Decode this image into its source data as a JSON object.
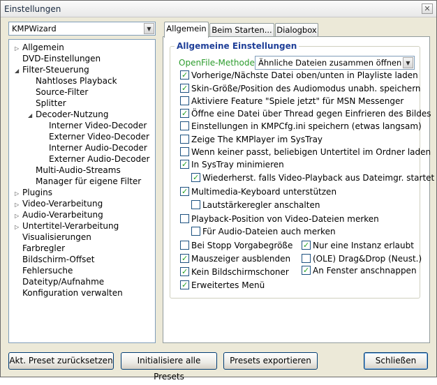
{
  "window": {
    "title": "Einstellungen",
    "close_glyph": "✕"
  },
  "preset": {
    "value": "KMPWizard"
  },
  "tree": {
    "items": [
      {
        "label": "Allgemein",
        "level": 0,
        "exp": "▷"
      },
      {
        "label": "DVD-Einstellungen",
        "level": 0,
        "exp": ""
      },
      {
        "label": "Filter-Steuerung",
        "level": 0,
        "exp": "◢"
      },
      {
        "label": "Nahtloses Playback",
        "level": 1,
        "exp": ""
      },
      {
        "label": "Source-Filter",
        "level": 1,
        "exp": ""
      },
      {
        "label": "Splitter",
        "level": 1,
        "exp": ""
      },
      {
        "label": "Decoder-Nutzung",
        "level": 1,
        "exp": "◢"
      },
      {
        "label": "Interner Video-Decoder",
        "level": 2,
        "exp": ""
      },
      {
        "label": "Externer Video-Decoder",
        "level": 2,
        "exp": ""
      },
      {
        "label": "Interner Audio-Decoder",
        "level": 2,
        "exp": ""
      },
      {
        "label": "Externer Audio-Decoder",
        "level": 2,
        "exp": ""
      },
      {
        "label": "Multi-Audio-Streams",
        "level": 1,
        "exp": ""
      },
      {
        "label": "Manager für eigene Filter",
        "level": 1,
        "exp": ""
      },
      {
        "label": "Plugins",
        "level": 0,
        "exp": "▷"
      },
      {
        "label": "Video-Verarbeitung",
        "level": 0,
        "exp": "▷"
      },
      {
        "label": "Audio-Verarbeitung",
        "level": 0,
        "exp": "▷"
      },
      {
        "label": "Untertitel-Verarbeitung",
        "level": 0,
        "exp": "▷"
      },
      {
        "label": "Visualisierungen",
        "level": 0,
        "exp": ""
      },
      {
        "label": "Farbregler",
        "level": 0,
        "exp": ""
      },
      {
        "label": "Bildschirm-Offset",
        "level": 0,
        "exp": ""
      },
      {
        "label": "Fehlersuche",
        "level": 0,
        "exp": ""
      },
      {
        "label": "Dateityp/Aufnahme",
        "level": 0,
        "exp": ""
      },
      {
        "label": "Konfiguration verwalten",
        "level": 0,
        "exp": ""
      }
    ]
  },
  "tabs": [
    {
      "label": "Allgemein",
      "active": true
    },
    {
      "label": "Beim Starten...",
      "active": false
    },
    {
      "label": "Dialogbox",
      "active": false
    }
  ],
  "group": {
    "title": "Allgemeine Einstellungen",
    "openfile_label": "OpenFile-Methode:",
    "openfile_value": "Ähnliche Dateien zusammen öffnen (V",
    "options": [
      {
        "label": "Vorherige/Nächste Datei oben/unten in Playliste laden",
        "checked": true,
        "indent": 0
      },
      {
        "label": "Skin-Größe/Position des Audiomodus unabh. speichern",
        "checked": true,
        "indent": 0
      },
      {
        "label": "Aktiviere Feature \"Spiele jetzt\" für MSN Messenger",
        "checked": false,
        "indent": 0
      },
      {
        "label": "Öffne eine Datei über Thread gegen Einfrieren des Bildes",
        "checked": true,
        "indent": 0
      },
      {
        "label": "Einstellungen in KMPCfg.ini speichern (etwas langsam)",
        "checked": false,
        "indent": 0
      },
      {
        "label": "Zeige The KMPlayer im SysTray",
        "checked": false,
        "indent": 0
      },
      {
        "label": "Wenn keiner passt, beliebigen Untertitel im Ordner laden",
        "checked": false,
        "indent": 0
      },
      {
        "label": "In SysTray minimieren",
        "checked": true,
        "indent": 0
      },
      {
        "label": "Wiederherst. falls Video-Playback aus Dateimgr. startet",
        "checked": true,
        "indent": 1
      },
      {
        "label": "Multimedia-Keyboard unterstützen",
        "checked": true,
        "indent": 0
      },
      {
        "label": "Lautstärkeregler anschalten",
        "checked": false,
        "indent": 1
      },
      {
        "label": "Playback-Position von Video-Dateien merken",
        "checked": false,
        "indent": 0
      },
      {
        "label": "Für Audio-Dateien auch merken",
        "checked": false,
        "indent": 1
      }
    ],
    "left_col": [
      {
        "label": "Bei Stopp Vorgabegröße",
        "checked": false
      },
      {
        "label": "Mauszeiger ausblenden",
        "checked": true
      },
      {
        "label": "Kein Bildschirmschoner",
        "checked": true
      },
      {
        "label": "Erweitertes Menü",
        "checked": true
      }
    ],
    "right_col": [
      {
        "label": "Nur eine Instanz erlaubt",
        "checked": true
      },
      {
        "label": "(OLE) Drag&Drop (Neust.)",
        "checked": false
      },
      {
        "label": "An Fenster anschnappen",
        "checked": true
      }
    ]
  },
  "buttons": {
    "reset": "Akt. Preset zurücksetzen",
    "init": "Initialisiere alle Presets",
    "export": "Presets exportieren",
    "close": "Schließen"
  },
  "icons": {
    "dropdown": "chevron-down-icon",
    "close": "close-icon"
  }
}
